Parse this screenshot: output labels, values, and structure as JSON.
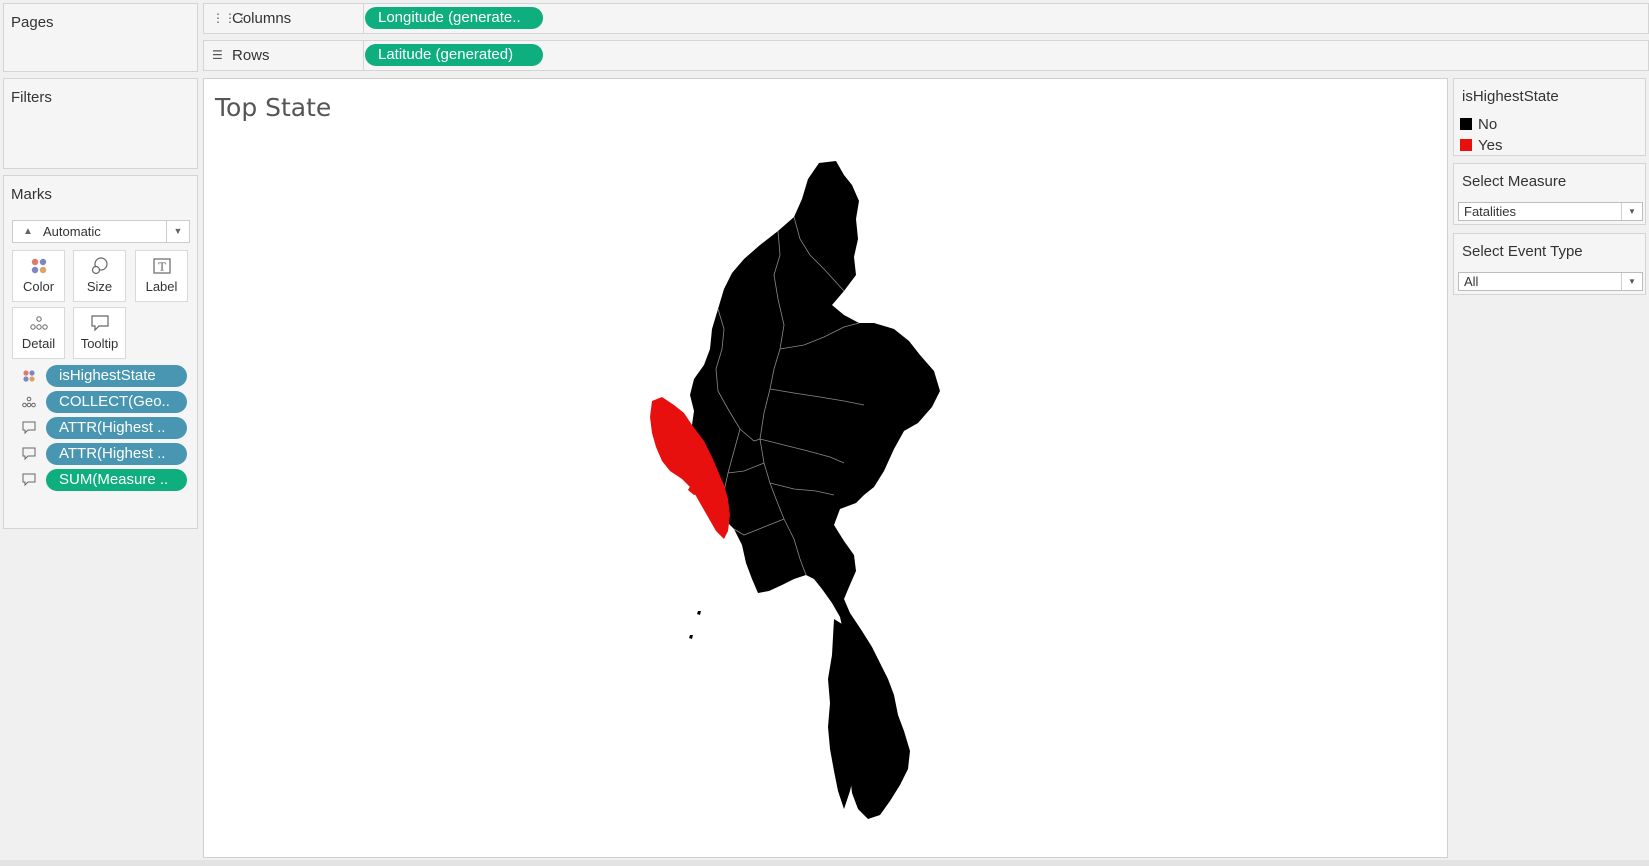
{
  "left_panes": {
    "pages_title": "Pages",
    "filters_title": "Filters",
    "marks": {
      "title": "Marks",
      "mark_type": "Automatic",
      "buttons": [
        "Color",
        "Size",
        "Label",
        "Detail",
        "Tooltip"
      ],
      "fields": [
        {
          "icon": "color-dots-icon",
          "label": "isHighestState",
          "type": "dimension"
        },
        {
          "icon": "detail-icon",
          "label": "COLLECT(Geo..",
          "type": "dimension"
        },
        {
          "icon": "tooltip-icon",
          "label": "ATTR(Highest ..",
          "type": "dimension"
        },
        {
          "icon": "tooltip-icon",
          "label": "ATTR(Highest ..",
          "type": "dimension"
        },
        {
          "icon": "tooltip-icon",
          "label": "SUM(Measure ..",
          "type": "measure"
        }
      ]
    }
  },
  "shelves": {
    "columns": {
      "label": "Columns",
      "icon": "columns-icon",
      "pill": "Longitude (generate.."
    },
    "rows": {
      "label": "Rows",
      "icon": "rows-icon",
      "pill": "Latitude (generated)"
    }
  },
  "viz": {
    "title": "Top State",
    "map": {
      "region_color": "#000000",
      "highlight_color": "#e8100f",
      "border_color": "#8a8a8a"
    }
  },
  "right_panes": {
    "legend": {
      "title": "isHighestState",
      "items": [
        {
          "label": "No",
          "color": "#000000"
        },
        {
          "label": "Yes",
          "color": "#e8100f"
        }
      ]
    },
    "select_measure": {
      "title": "Select Measure",
      "value": "Fatalities"
    },
    "select_event_type": {
      "title": "Select Event Type",
      "value": "All"
    }
  },
  "colors": {
    "green_pill": "#0fae7f",
    "blue_pill": "#4996b2"
  }
}
